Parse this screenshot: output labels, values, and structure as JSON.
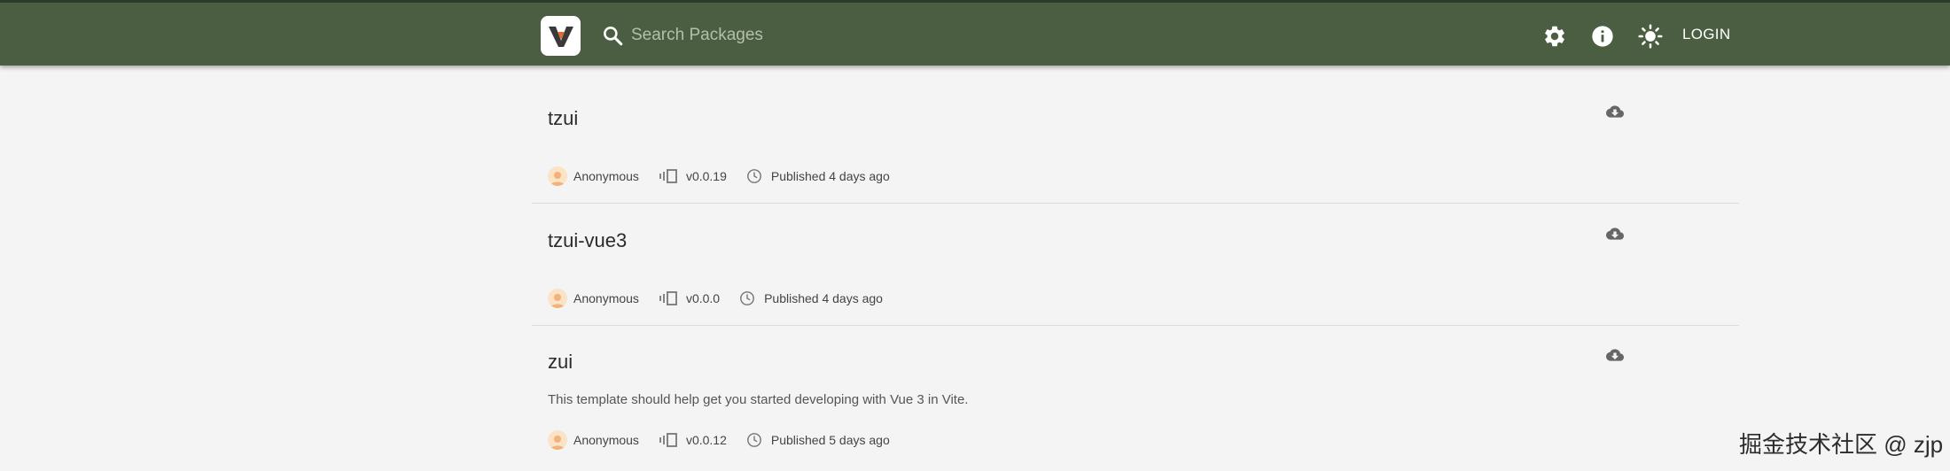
{
  "header": {
    "search": {
      "placeholder": "Search Packages"
    },
    "login_label": "LOGIN",
    "icons": [
      "settings-icon",
      "info-icon",
      "theme-toggle-icon"
    ],
    "colors": {
      "bar": "#4b5e41",
      "accent": "#e06a2c"
    }
  },
  "packages": [
    {
      "name": "tzui",
      "description": "",
      "author": "Anonymous",
      "version": "v0.0.19",
      "published": "Published 4 days ago"
    },
    {
      "name": "tzui-vue3",
      "description": "",
      "author": "Anonymous",
      "version": "v0.0.0",
      "published": "Published 4 days ago"
    },
    {
      "name": "zui",
      "description": "This template should help get you started developing with Vue 3 in Vite.",
      "author": "Anonymous",
      "version": "v0.0.12",
      "published": "Published 5 days ago"
    }
  ],
  "watermark": "掘金技术社区 @ zjp"
}
